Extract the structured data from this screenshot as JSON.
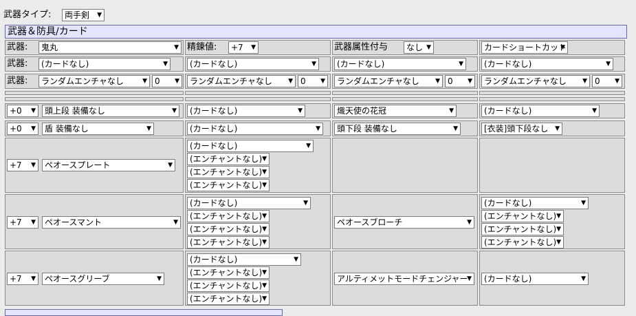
{
  "weapon_type": {
    "label": "武器タイプ:",
    "value": "両手剣"
  },
  "section_title": "武器＆防具/カード",
  "weapon_row": {
    "weapon_label": "武器:",
    "weapon_value": "鬼丸",
    "refine_label": "精錬値:",
    "refine_value": "+7",
    "element_label": "武器属性付与",
    "element_value": "なし",
    "shortcut_value": "カードショートカット"
  },
  "card_row": {
    "label": "武器:",
    "cards": [
      "(カードなし)",
      "(カードなし)",
      "(カードなし)",
      "(カードなし)"
    ]
  },
  "enchant_row": {
    "label": "武器:",
    "enchants": [
      "ランダムエンチャなし",
      "ランダムエンチャなし",
      "ランダムエンチャなし",
      "ランダムエンチャなし"
    ],
    "levels": [
      "0",
      "0",
      "0",
      "0"
    ]
  },
  "head_top": {
    "refine": "+0",
    "item": "頭上段 装備なし",
    "card": "(カードなし)",
    "mid_item": "熾天使の花冠",
    "mid_card": "(カードなし)"
  },
  "shield": {
    "refine": "+0",
    "item": "盾 装備なし",
    "card": "(カードなし)",
    "low_item": "頭下段 装備なし",
    "costume": "[衣装]頭下段なし"
  },
  "armor": {
    "refine": "+7",
    "item": "ペオースプレート",
    "card": "(カードなし)",
    "enchants": [
      "(エンチャントなし)",
      "(エンチャントなし)",
      "(エンチャントなし)"
    ]
  },
  "garment": {
    "refine": "+7",
    "item": "ペオースマント",
    "card": "(カードなし)",
    "enchants": [
      "(エンチャントなし)",
      "(エンチャントなし)",
      "(エンチャントなし)"
    ],
    "acc_item": "ペオースブローチ",
    "acc_card": "(カードなし)",
    "acc_enchants": [
      "(エンチャントなし)",
      "(エンチャントなし)",
      "(エンチャントなし)"
    ]
  },
  "shoes": {
    "refine": "+7",
    "item": "ペオースグリーブ",
    "card": "(カードなし)",
    "enchants": [
      "(エンチャントなし)",
      "(エンチャントなし)",
      "(エンチャントなし)"
    ],
    "acc2_item": "アルティメットモードチェンジャー",
    "acc2_card": "(カードなし)"
  }
}
